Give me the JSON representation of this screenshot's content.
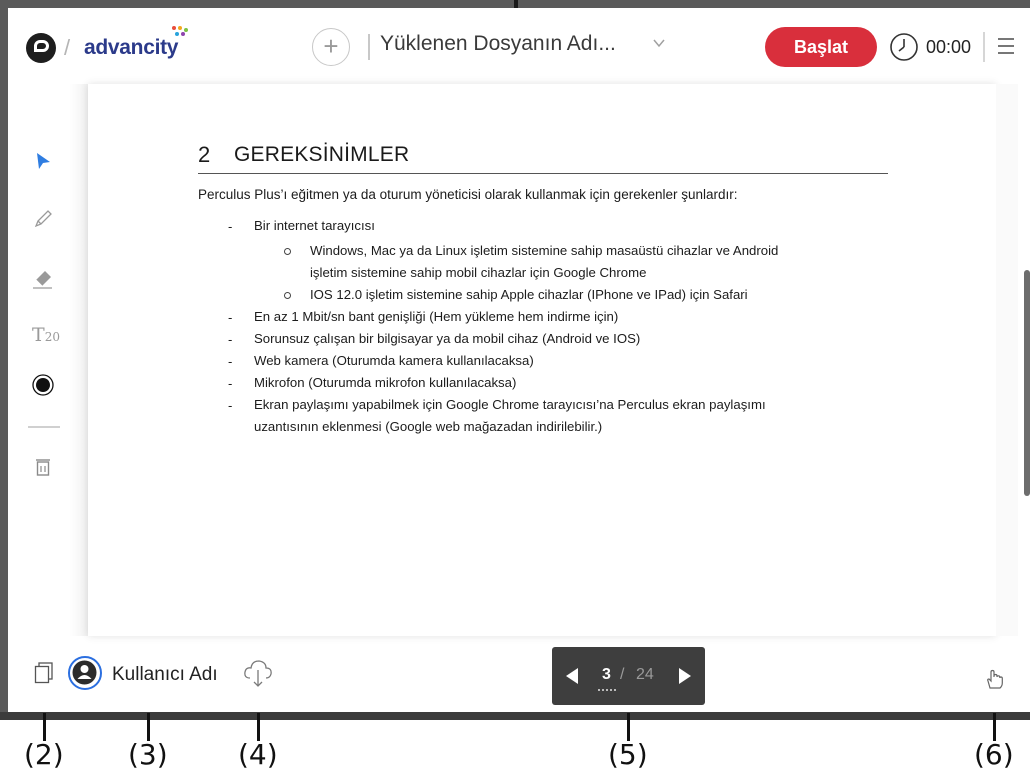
{
  "header": {
    "brand": "advancity",
    "file_title": "Yüklenen Dosyanın Adı...",
    "start_label": "Başlat",
    "timer": "00:00"
  },
  "document": {
    "section_number": "2",
    "section_title": "GEREKSİNİMLER",
    "intro": "Perculus Plus’ı eğitmen ya da oturum yöneticisi olarak kullanmak için gerekenler şunlardır:",
    "bullet_browser": "Bir internet tarayıcısı",
    "sub_windows_line1": "Windows, Mac ya da Linux işletim sistemine sahip masaüstü cihazlar ve Android",
    "sub_windows_line2": "işletim sistemine sahip mobil cihazlar için Google Chrome",
    "sub_ios": "IOS 12.0 işletim sistemine sahip Apple cihazlar (IPhone ve IPad) için Safari",
    "bullet_bandwidth": "En az 1 Mbit/sn bant genişliği (Hem yükleme hem indirme için)",
    "bullet_device": "Sorunsuz çalışan bir bilgisayar ya da mobil cihaz (Android ve IOS)",
    "bullet_camera": "Web kamera (Oturumda kamera kullanılacaksa)",
    "bullet_mic": "Mikrofon (Oturumda mikrofon kullanılacaksa)",
    "bullet_share_line1": "Ekran paylaşımı yapabilmek için Google Chrome tarayıcısı’na Perculus ekran paylaşımı",
    "bullet_share_line2": "uzantısının eklenmesi (Google web mağazadan indirilebilir.)",
    "dash": "-"
  },
  "toolbar": {
    "text_tool_letter": "T",
    "text_tool_size": "20"
  },
  "footer": {
    "username": "Kullanıcı Adı",
    "page_current": "3",
    "page_separator": "/",
    "page_total": "24"
  },
  "callouts": [
    "(2)",
    "(3)",
    "(4)",
    "(5)",
    "(6)"
  ],
  "colors": {
    "accent_red": "#d92f3c",
    "accent_blue": "#2b6fe0",
    "brand_navy": "#2b3a8a",
    "pager_bg": "#3e3e3e"
  },
  "icons": [
    "logo-icon",
    "plus-icon",
    "chevron-down-icon",
    "clock-icon",
    "menu-icon",
    "pointer-icon",
    "pencil-icon",
    "eraser-icon",
    "text-size-icon",
    "color-dot-icon",
    "trash-icon",
    "pages-icon",
    "user-avatar-icon",
    "cloud-download-icon",
    "hand-icon"
  ]
}
